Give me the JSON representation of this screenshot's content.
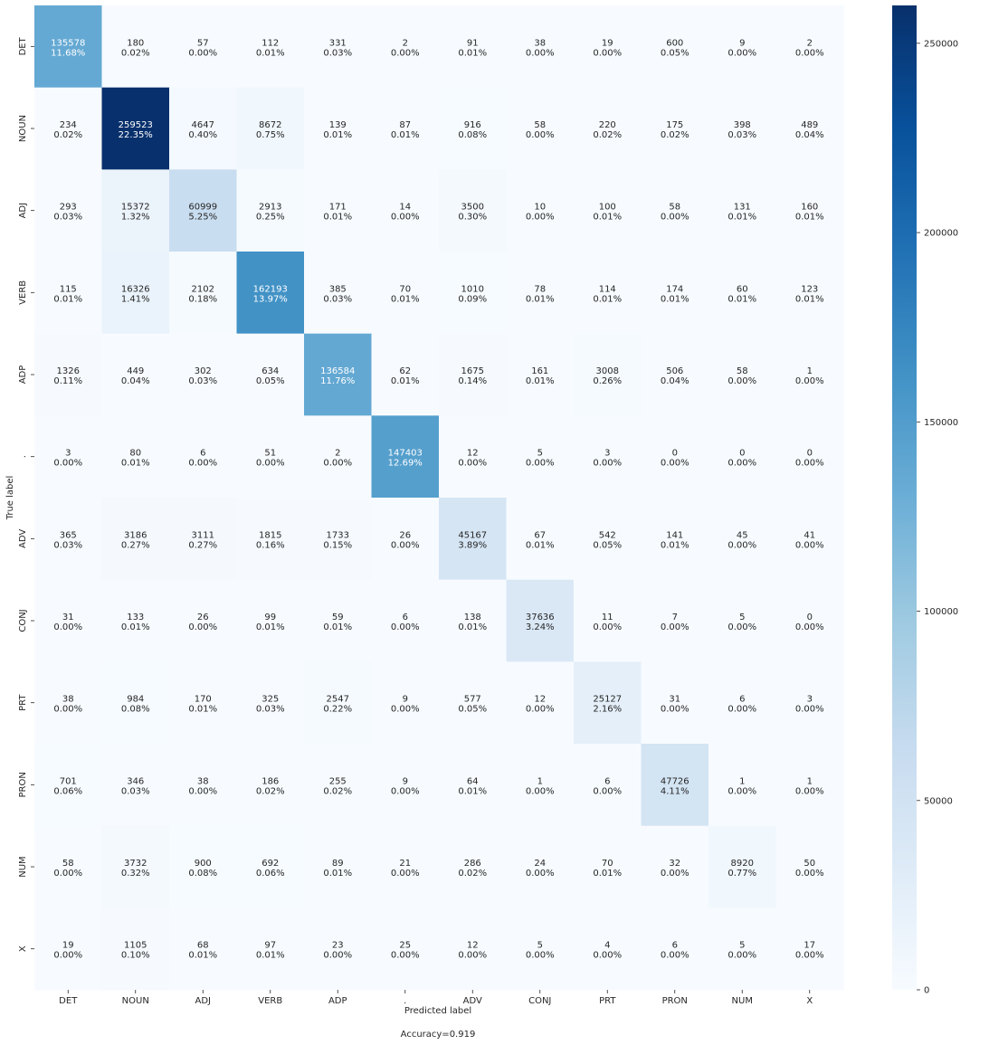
{
  "chart_data": {
    "type": "heatmap",
    "xlabel": "Predicted label",
    "ylabel": "True label",
    "footer": "Accuracy=0.919",
    "categories": [
      "DET",
      "NOUN",
      "ADJ",
      "VERB",
      "ADP",
      ".",
      "ADV",
      "CONJ",
      "PRT",
      "PRON",
      "NUM",
      "X"
    ],
    "colormap": "Blues",
    "colorbar": {
      "min": 0,
      "max": 260000,
      "ticks": [
        0,
        50000,
        100000,
        150000,
        200000,
        250000
      ]
    },
    "counts": [
      [
        135578,
        180,
        57,
        112,
        331,
        2,
        91,
        38,
        19,
        600,
        9,
        2
      ],
      [
        234,
        259523,
        4647,
        8672,
        139,
        87,
        916,
        58,
        220,
        175,
        398,
        489
      ],
      [
        293,
        15372,
        60999,
        2913,
        171,
        14,
        3500,
        10,
        100,
        58,
        131,
        160
      ],
      [
        115,
        16326,
        2102,
        162193,
        385,
        70,
        1010,
        78,
        114,
        174,
        60,
        123
      ],
      [
        1326,
        449,
        302,
        634,
        136584,
        62,
        1675,
        161,
        3008,
        506,
        58,
        1
      ],
      [
        3,
        80,
        6,
        51,
        2,
        147403,
        12,
        5,
        3,
        0,
        0,
        0
      ],
      [
        365,
        3186,
        3111,
        1815,
        1733,
        26,
        45167,
        67,
        542,
        141,
        45,
        41
      ],
      [
        31,
        133,
        26,
        99,
        59,
        6,
        138,
        37636,
        11,
        7,
        5,
        0
      ],
      [
        38,
        984,
        170,
        325,
        2547,
        9,
        577,
        12,
        25127,
        31,
        6,
        3
      ],
      [
        701,
        346,
        38,
        186,
        255,
        9,
        64,
        1,
        6,
        47726,
        1,
        1
      ],
      [
        58,
        3732,
        900,
        692,
        89,
        21,
        286,
        24,
        70,
        32,
        8920,
        50
      ],
      [
        19,
        1105,
        68,
        97,
        23,
        25,
        12,
        5,
        4,
        6,
        5,
        17
      ]
    ],
    "percents": [
      [
        "11.68%",
        "0.02%",
        "0.00%",
        "0.01%",
        "0.03%",
        "0.00%",
        "0.01%",
        "0.00%",
        "0.00%",
        "0.05%",
        "0.00%",
        "0.00%"
      ],
      [
        "0.02%",
        "22.35%",
        "0.40%",
        "0.75%",
        "0.01%",
        "0.01%",
        "0.08%",
        "0.00%",
        "0.02%",
        "0.02%",
        "0.03%",
        "0.04%"
      ],
      [
        "0.03%",
        "1.32%",
        "5.25%",
        "0.25%",
        "0.01%",
        "0.00%",
        "0.30%",
        "0.00%",
        "0.01%",
        "0.00%",
        "0.01%",
        "0.01%"
      ],
      [
        "0.01%",
        "1.41%",
        "0.18%",
        "13.97%",
        "0.03%",
        "0.01%",
        "0.09%",
        "0.01%",
        "0.01%",
        "0.01%",
        "0.01%",
        "0.01%"
      ],
      [
        "0.11%",
        "0.04%",
        "0.03%",
        "0.05%",
        "11.76%",
        "0.01%",
        "0.14%",
        "0.01%",
        "0.26%",
        "0.04%",
        "0.00%",
        "0.00%"
      ],
      [
        "0.00%",
        "0.01%",
        "0.00%",
        "0.00%",
        "0.00%",
        "12.69%",
        "0.00%",
        "0.00%",
        "0.00%",
        "0.00%",
        "0.00%",
        "0.00%"
      ],
      [
        "0.03%",
        "0.27%",
        "0.27%",
        "0.16%",
        "0.15%",
        "0.00%",
        "3.89%",
        "0.01%",
        "0.05%",
        "0.01%",
        "0.00%",
        "0.00%"
      ],
      [
        "0.00%",
        "0.01%",
        "0.00%",
        "0.01%",
        "0.01%",
        "0.00%",
        "0.01%",
        "3.24%",
        "0.00%",
        "0.00%",
        "0.00%",
        "0.00%"
      ],
      [
        "0.00%",
        "0.08%",
        "0.01%",
        "0.03%",
        "0.22%",
        "0.00%",
        "0.05%",
        "0.00%",
        "2.16%",
        "0.00%",
        "0.00%",
        "0.00%"
      ],
      [
        "0.06%",
        "0.03%",
        "0.00%",
        "0.02%",
        "0.02%",
        "0.00%",
        "0.01%",
        "0.00%",
        "0.00%",
        "4.11%",
        "0.00%",
        "0.00%"
      ],
      [
        "0.00%",
        "0.32%",
        "0.08%",
        "0.06%",
        "0.01%",
        "0.00%",
        "0.02%",
        "0.00%",
        "0.01%",
        "0.00%",
        "0.77%",
        "0.00%"
      ],
      [
        "0.00%",
        "0.10%",
        "0.01%",
        "0.01%",
        "0.00%",
        "0.00%",
        "0.00%",
        "0.00%",
        "0.00%",
        "0.00%",
        "0.00%",
        "0.00%"
      ]
    ]
  }
}
